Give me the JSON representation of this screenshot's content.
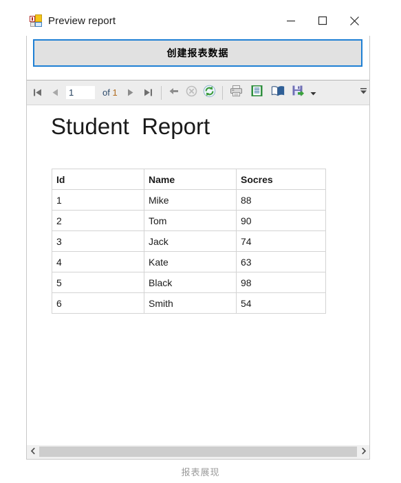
{
  "window": {
    "title": "Preview report",
    "icon": "winforms-app-icon",
    "controls": {
      "minimize": "minimize-icon",
      "maximize": "maximize-icon",
      "close": "close-icon"
    }
  },
  "top_panel": {
    "create_button_label": "创建报表数据",
    "focus_border_color": "#1e7fd4",
    "button_face_color": "#e1e1e1"
  },
  "report_viewer": {
    "toolbar": {
      "first_page_icon": "first-page-icon",
      "prev_page_icon": "previous-page-icon",
      "current_page": "1",
      "of_label": "of",
      "total_pages": "1",
      "next_page_icon": "next-page-icon",
      "last_page_icon": "last-page-icon",
      "back_icon": "back-parent-report-icon",
      "stop_icon": "stop-icon",
      "refresh_icon": "refresh-icon",
      "print_icon": "print-icon",
      "print_layout_icon": "print-layout-icon",
      "page_setup_icon": "page-setup-icon",
      "export_icon": "export-save-icon",
      "export_dropdown_icon": "chevron-down-icon",
      "overflow_icon": "toolbar-overflow-icon"
    },
    "report": {
      "title": "Student  Report",
      "table": {
        "columns": [
          "Id",
          "Name",
          "Socres"
        ],
        "rows": [
          {
            "id": "1",
            "name": "Mike",
            "score": "88"
          },
          {
            "id": "2",
            "name": "Tom",
            "score": "90"
          },
          {
            "id": "3",
            "name": "Jack",
            "score": "74"
          },
          {
            "id": "4",
            "name": "Kate",
            "score": "63"
          },
          {
            "id": "5",
            "name": "Black",
            "score": "98"
          },
          {
            "id": "6",
            "name": "Smith",
            "score": "54"
          }
        ]
      }
    },
    "scrollbar": {
      "left_arrow_icon": "scroll-left-icon",
      "right_arrow_icon": "scroll-right-icon"
    }
  },
  "caption": "报表展现"
}
